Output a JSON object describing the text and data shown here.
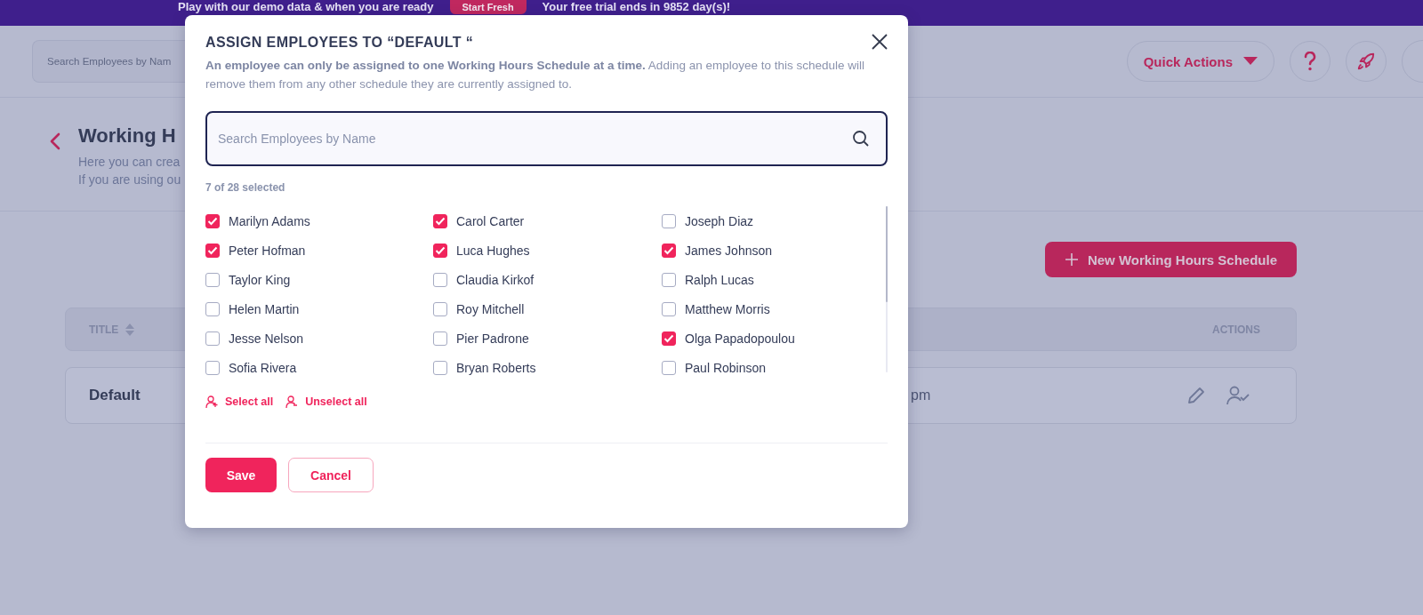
{
  "banner": {
    "text_before": "Play with our demo data & when you are ready",
    "button": "Start Fresh",
    "text_after": "Your free trial ends in 9852 day(s)!"
  },
  "header": {
    "search_placeholder": "Search Employees by Nam",
    "quick_actions": "Quick Actions"
  },
  "page": {
    "title": "Working H",
    "description": [
      "Here you can crea",
      "If you are using ou"
    ]
  },
  "new_button": "New Working Hours Schedule",
  "table": {
    "columns": [
      "TITLE",
      "ACTIONS"
    ],
    "rows": [
      {
        "title": "Default",
        "column_2": "pm"
      }
    ]
  },
  "modal": {
    "title": "ASSIGN EMPLOYEES TO “DEFAULT “",
    "note": "**An employee can only be assigned to one Working Hours Schedule at a time.** Adding an employee to this schedule will remove them from any other schedule they are currently assigned to.",
    "search_placeholder": "Search Employees by Name",
    "count": "7 of 28 selected",
    "employees": [
      {
        "name": "Marilyn Adams",
        "checked": true
      },
      {
        "name": "Carol Carter",
        "checked": true
      },
      {
        "name": "Joseph Diaz",
        "checked": false
      },
      {
        "name": "Peter Hofman",
        "checked": true
      },
      {
        "name": "Luca Hughes",
        "checked": true
      },
      {
        "name": "James Johnson",
        "checked": true
      },
      {
        "name": "Taylor King",
        "checked": false
      },
      {
        "name": "Claudia Kirkof",
        "checked": false
      },
      {
        "name": "Ralph Lucas",
        "checked": false
      },
      {
        "name": "Helen Martin",
        "checked": false
      },
      {
        "name": "Roy Mitchell",
        "checked": false
      },
      {
        "name": "Matthew Morris",
        "checked": false
      },
      {
        "name": "Jesse Nelson",
        "checked": false
      },
      {
        "name": "Pier Padrone",
        "checked": false
      },
      {
        "name": "Olga Papadopoulou",
        "checked": true
      },
      {
        "name": "Sofia Rivera",
        "checked": false
      },
      {
        "name": "Bryan Roberts",
        "checked": false
      },
      {
        "name": "Paul Robinson",
        "checked": false
      }
    ],
    "select_all": "Select all",
    "unselect_all": "Unselect all",
    "save": "Save",
    "cancel": "Cancel"
  }
}
